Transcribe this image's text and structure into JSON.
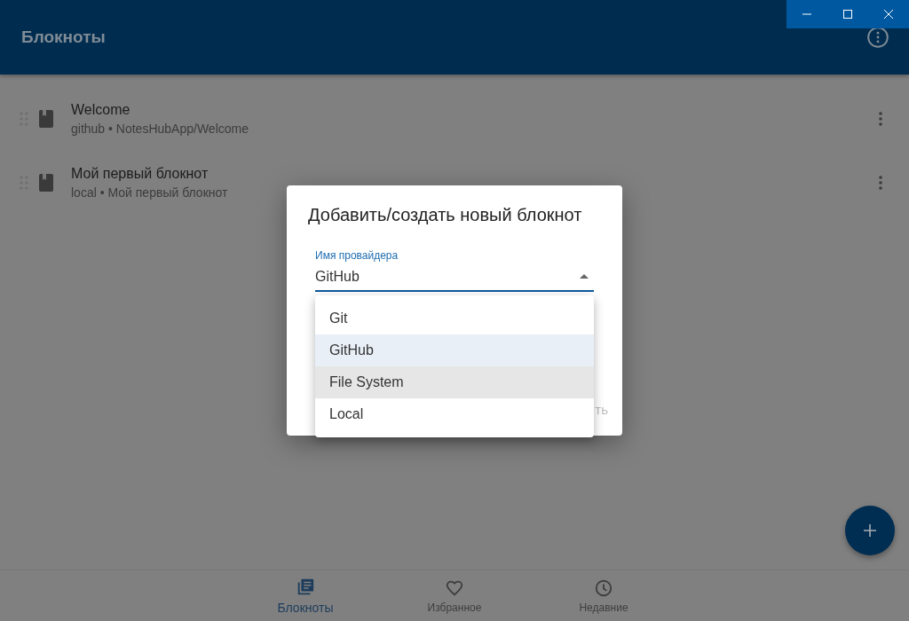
{
  "app_bar": {
    "title": "Блокноты"
  },
  "notebooks": [
    {
      "name": "Welcome",
      "source": "github • NotesHubApp/Welcome"
    },
    {
      "name": "Мой первый блокнот",
      "source": "local • Мой первый блокнот"
    }
  ],
  "dialog": {
    "title": "Добавить/создать новый блокнот",
    "field": {
      "label": "Имя провайдера",
      "value": "GitHub",
      "expanded": true
    },
    "options": [
      {
        "label": "Git",
        "selected": false,
        "hovered": false
      },
      {
        "label": "GitHub",
        "selected": true,
        "hovered": false
      },
      {
        "label": "File System",
        "selected": false,
        "hovered": true
      },
      {
        "label": "Local",
        "selected": false,
        "hovered": false
      }
    ],
    "action": {
      "label": "ть",
      "disabled": true
    }
  },
  "bottom_nav": [
    {
      "label": "Блокноты",
      "selected": true
    },
    {
      "label": "Избранное",
      "selected": false
    },
    {
      "label": "Недавние",
      "selected": false
    }
  ]
}
